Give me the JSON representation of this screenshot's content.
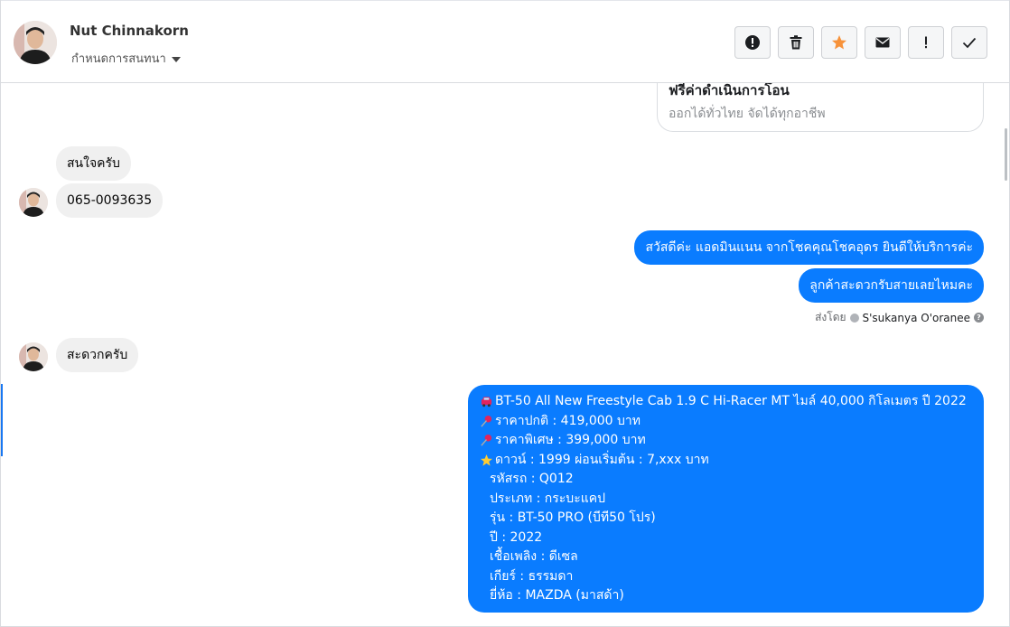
{
  "header": {
    "contact_name": "Nut Chinnakorn",
    "assign_label": "กำหนดการสนทนา",
    "toolbar": [
      {
        "name": "report-spam-button",
        "icon": "alert-circle-icon"
      },
      {
        "name": "delete-button",
        "icon": "trash-icon"
      },
      {
        "name": "star-button",
        "icon": "star-icon",
        "color": "#f7923a"
      },
      {
        "name": "mark-unread-button",
        "icon": "envelope-icon"
      },
      {
        "name": "follow-up-button",
        "icon": "exclamation-icon"
      },
      {
        "name": "mark-done-button",
        "icon": "checkmark-icon"
      }
    ]
  },
  "card": {
    "title": "ฟรีค่าดำเนินการโอน",
    "subtitle": "ออกได้ทั่วไทย จัดได้ทุกอาชีพ"
  },
  "messages": {
    "in1": "สนใจครับ",
    "in2": "065-0093635",
    "out1": "สวัสดีค่ะ แอดมินแนน จากโชคคุณโชคอุดร ยินดีให้บริการค่ะ",
    "out2": "ลูกค้าสะดวกรับสายเลยไหมคะ",
    "sent_by_label": "ส่งโดย",
    "sent_by_name": "S'sukanya O'oranee",
    "in3": "สะดวกครับ"
  },
  "listing": {
    "line1": "BT-50 All New Freestyle Cab 1.9 C Hi-Racer MT ไมล์ 40,000 กิโลเมตร ปี 2022",
    "line2": "ราคาปกติ : 419,000 บาท",
    "line3": "ราคาพิเศษ : 399,000 บาท",
    "line4": "ดาวน์ : 1999 ผ่อนเริ่มต้น : 7,xxx บาท",
    "line5": "รหัสรถ : Q012",
    "line6": "ประเภท : กระบะแคป",
    "line7": "รุ่น : BT-50 PRO (บีที50 โปร)",
    "line8": "ปี : 2022",
    "line9": "เชื้อเพลิง : ดีเซล",
    "line10": "เกียร์ : ธรรมดา",
    "line11": "ยี่ห้อ : MAZDA (มาสด้า)"
  },
  "colors": {
    "outgoing_bubble": "#0a7cff",
    "incoming_bubble": "#f0f0f0",
    "star": "#f7923a"
  }
}
